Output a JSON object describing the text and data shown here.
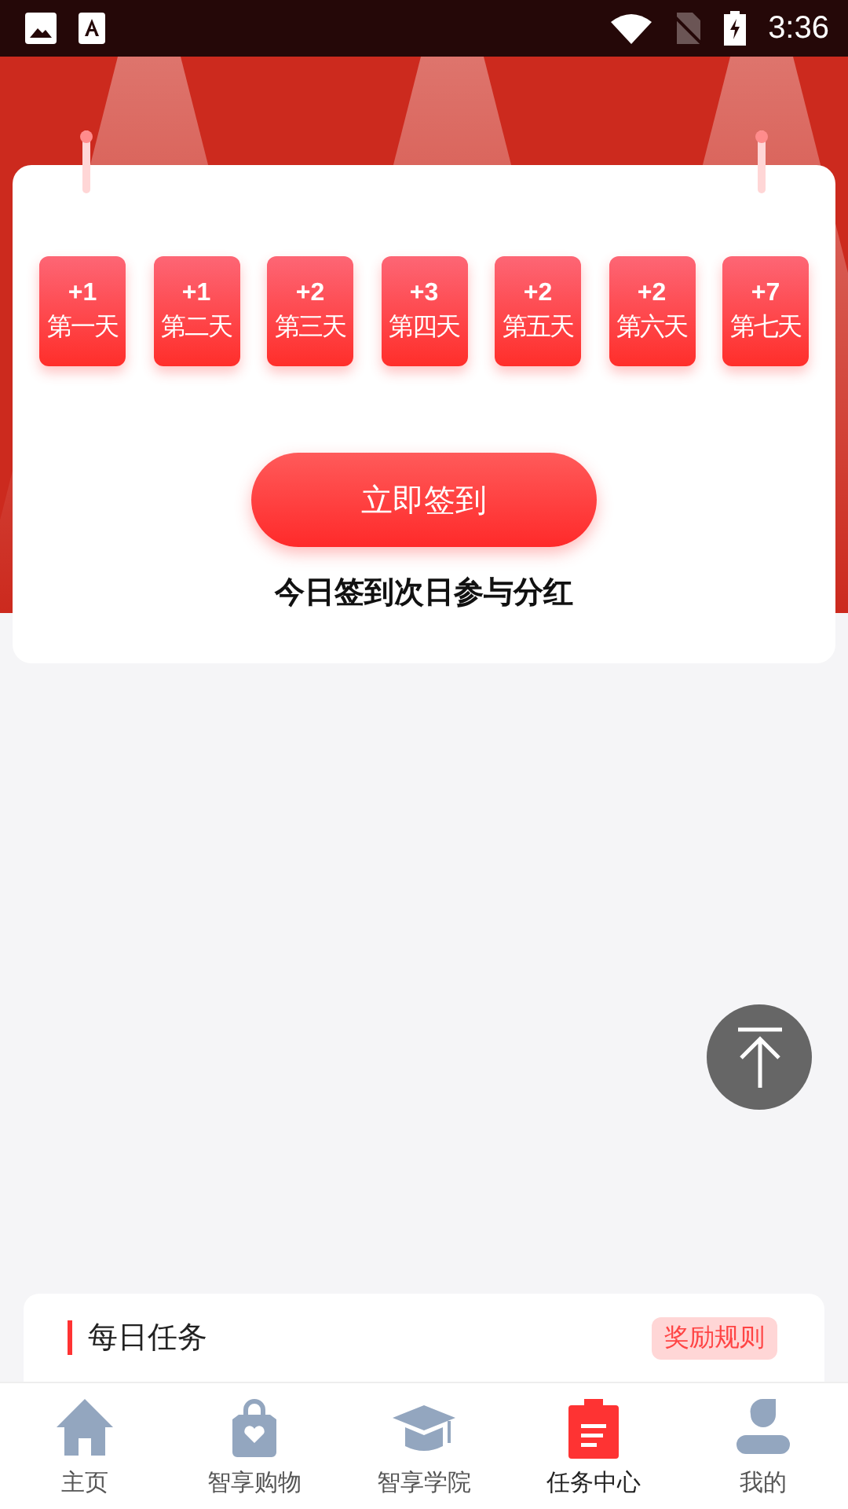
{
  "status_bar": {
    "time": "3:36"
  },
  "checkin": {
    "days": [
      {
        "points": "+1",
        "label": "第一天"
      },
      {
        "points": "+1",
        "label": "第二天"
      },
      {
        "points": "+2",
        "label": "第三天"
      },
      {
        "points": "+3",
        "label": "第四天"
      },
      {
        "points": "+2",
        "label": "第五天"
      },
      {
        "points": "+2",
        "label": "第六天"
      },
      {
        "points": "+7",
        "label": "第七天"
      }
    ],
    "button": "立即签到",
    "caption": "今日签到次日参与分红"
  },
  "tasks": {
    "title": "每日任务",
    "rules_button": "奖励规则"
  },
  "tabs": [
    {
      "label": "主页",
      "kind": "home",
      "selected": false
    },
    {
      "label": "智享购物",
      "kind": "bag",
      "selected": false
    },
    {
      "label": "智享学院",
      "kind": "cap",
      "selected": false
    },
    {
      "label": "任务中心",
      "kind": "clipboard",
      "selected": true
    },
    {
      "label": "我的",
      "kind": "user",
      "selected": false
    }
  ]
}
